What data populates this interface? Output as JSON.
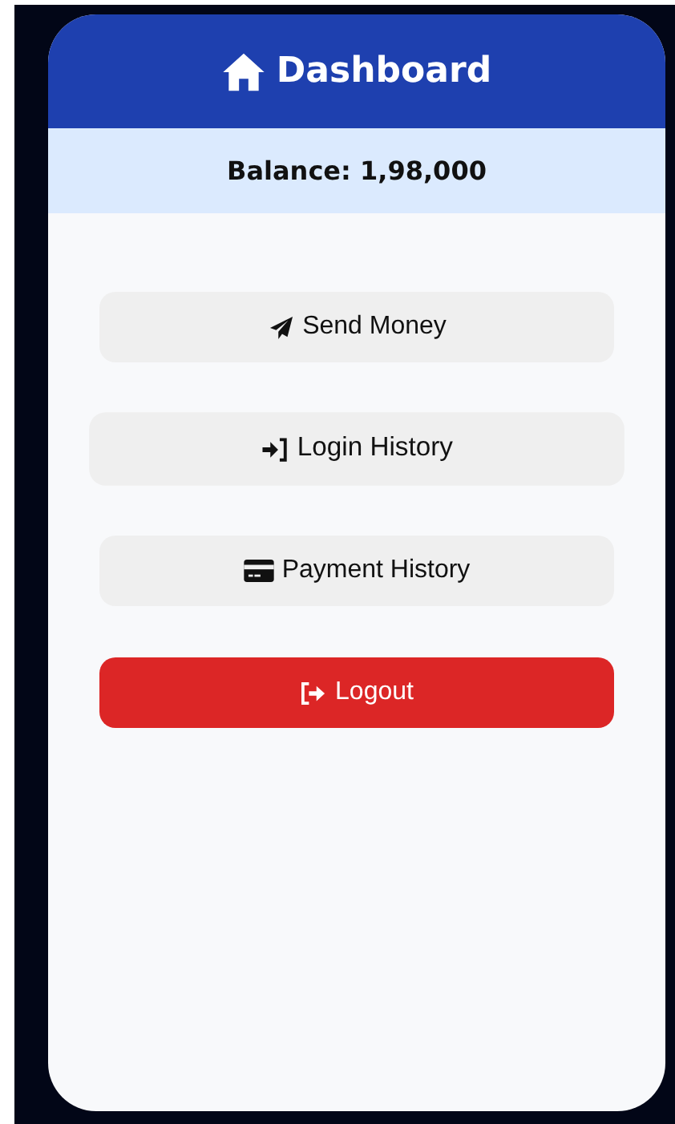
{
  "header": {
    "title": "Dashboard"
  },
  "balance": {
    "text": "Balance: 1,98,000"
  },
  "buttons": [
    {
      "label": "Send Money",
      "kind": "default",
      "hovered": false
    },
    {
      "label": "Login History",
      "kind": "default",
      "hovered": true
    },
    {
      "label": "Payment History",
      "kind": "default",
      "hovered": false
    },
    {
      "label": "Logout",
      "kind": "danger",
      "hovered": false
    }
  ]
}
